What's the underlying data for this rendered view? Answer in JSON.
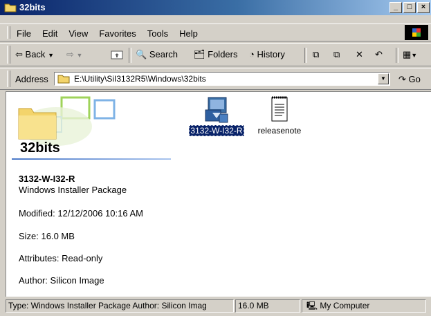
{
  "window": {
    "title": "32bits"
  },
  "menu": [
    "File",
    "Edit",
    "View",
    "Favorites",
    "Tools",
    "Help"
  ],
  "toolbar": {
    "back": "Back",
    "search": "Search",
    "folders": "Folders",
    "history": "History"
  },
  "address": {
    "label": "Address",
    "value": "E:\\Utility\\SiI3132R5\\Windows\\32bits",
    "go": "Go"
  },
  "panel": {
    "title": "32bits",
    "selected_name": "3132-W-I32-R",
    "selected_type": "Windows Installer Package",
    "modified": "Modified: 12/12/2006 10:16 AM",
    "size": "Size: 16.0 MB",
    "attributes": "Attributes: Read-only",
    "author": "Author: Silicon Image"
  },
  "files": [
    {
      "name": "3132-W-I32-R",
      "icon": "installer-package-icon",
      "selected": true
    },
    {
      "name": "releasenote",
      "icon": "text-document-icon",
      "selected": false
    }
  ],
  "status": {
    "info": "Type: Windows Installer Package Author: Silicon Imag",
    "size": "16.0 MB",
    "zone": "My Computer"
  },
  "colors": {
    "titlebar_start": "#0a246a",
    "titlebar_end": "#a6caf0",
    "selection": "#0a246a"
  }
}
